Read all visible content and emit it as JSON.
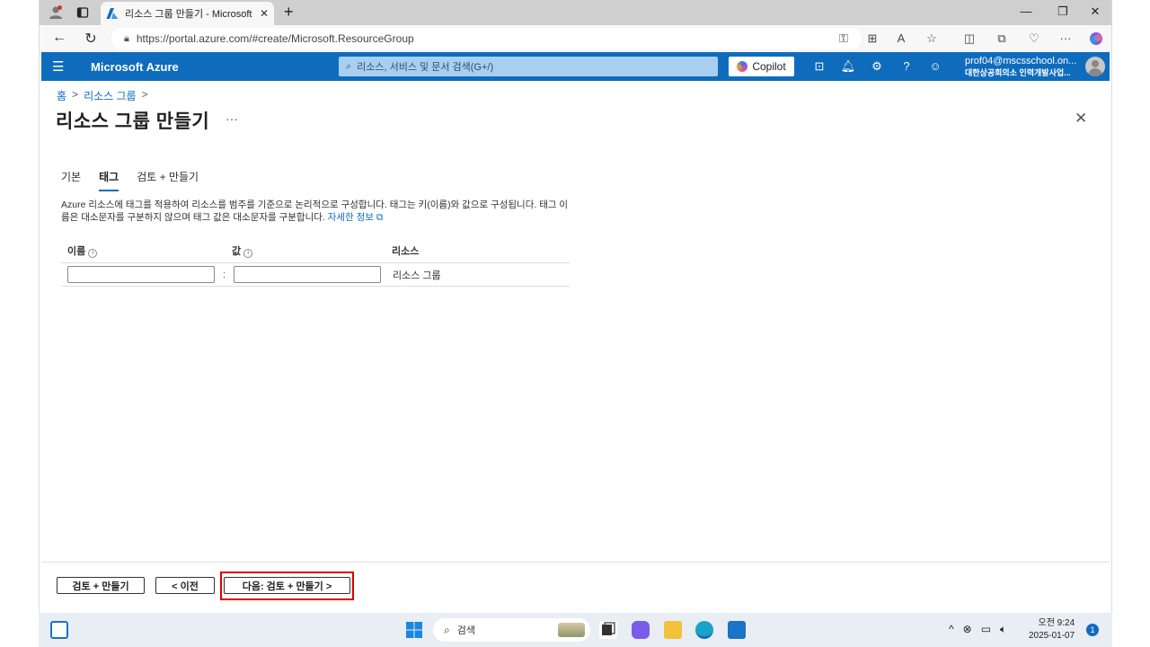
{
  "browser": {
    "tab_title": "리소스 그룹 만들기 - Microsoft Azure",
    "url": "https://portal.azure.com/#create/Microsoft.ResourceGroup"
  },
  "portal": {
    "brand": "Microsoft Azure",
    "search_placeholder": "리소스, 서비스 및 문서 검색(G+/)",
    "copilot_label": "Copilot",
    "account_email": "prof04@mscsschool.on...",
    "account_org": "대한상공회의소 인력개발사업..."
  },
  "breadcrumb": {
    "home": "홈",
    "resource_groups": "리소스 그룹",
    "sep": ">"
  },
  "page": {
    "title": "리소스 그룹 만들기",
    "more": "···"
  },
  "tabs": [
    {
      "label": "기본"
    },
    {
      "label": "태그"
    },
    {
      "label": "검토 + 만들기"
    }
  ],
  "description": {
    "text": "Azure 리소스에 태그를 적용하여 리소스를 범주를 기준으로 논리적으로 구성합니다. 태그는 키(이름)와 값으로 구성됩니다. 태그 이름은 대소문자를 구분하지 않으며 태그 값은 대소문자를 구분합니다.",
    "link": "자세한 정보"
  },
  "tag_table": {
    "headers": {
      "name": "이름",
      "value": "값",
      "resource": "리소스"
    },
    "rows": [
      {
        "name": "",
        "value": "",
        "separator": ":",
        "resource": "리소스 그룹"
      }
    ]
  },
  "footer": {
    "review_create": "검토 + 만들기",
    "previous": "< 이전",
    "next": "다음: 검토 + 만들기 >"
  },
  "taskbar": {
    "search_label": "검색",
    "time": "오전 9:24",
    "date": "2025-01-07",
    "notification_count": "1"
  },
  "colors": {
    "azure_header": "#0f6cbd",
    "highlight": "#e00000"
  }
}
